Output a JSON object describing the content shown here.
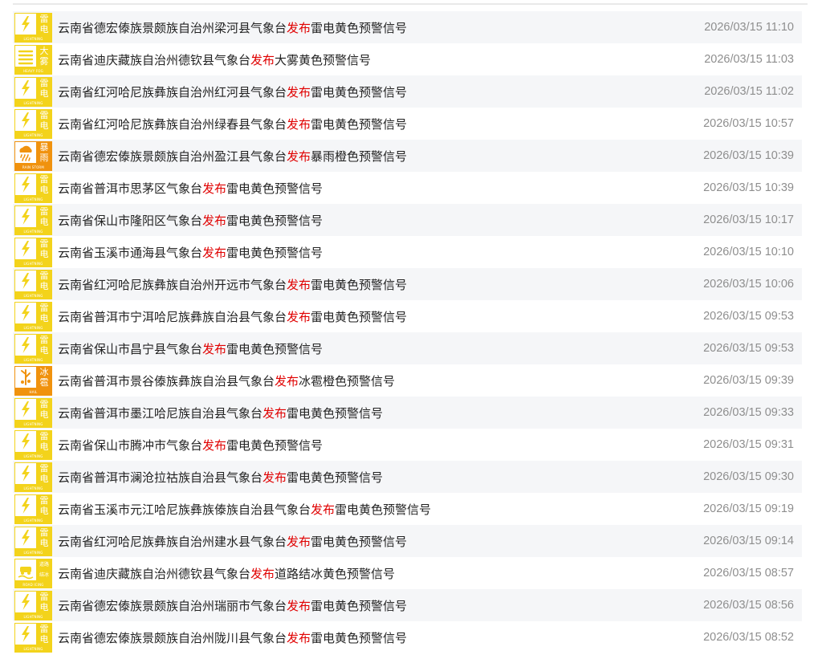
{
  "colors": {
    "yellow_icon": "#f3d31b",
    "orange_icon": "#f0920e",
    "verb_highlight": "#e00000",
    "title_text": "#222222",
    "time_text": "#8e8e8e",
    "row_alt": "#f5f6f8"
  },
  "verb": "发布",
  "icons": {
    "lightning": {
      "chars": [
        "雷",
        "电"
      ],
      "caption": "LIGHTNING",
      "color": "yellow",
      "glyph": "lightning-icon"
    },
    "fog": {
      "chars": [
        "大",
        "雾"
      ],
      "caption": "HEAVY FOG",
      "color": "yellow",
      "glyph": "fog-icon"
    },
    "rainstorm": {
      "chars": [
        "暴",
        "雨"
      ],
      "caption": "RAIN STORM",
      "color": "orange",
      "glyph": "rainstorm-icon"
    },
    "hail": {
      "chars": [
        "冰",
        "雹"
      ],
      "caption": "HAIL",
      "color": "orange",
      "glyph": "hail-icon"
    },
    "road_icing": {
      "chars": [
        "道路",
        "结冰"
      ],
      "caption": "ROAD ICING",
      "color": "yellow",
      "glyph": "road-icing-icon"
    }
  },
  "warnings": [
    {
      "icon": "lightning",
      "prefix": "云南省德宏傣族景颇族自治州梁河县气象台",
      "suffix": "雷电黄色预警信号",
      "time": "2026/03/15 11:10"
    },
    {
      "icon": "fog",
      "prefix": "云南省迪庆藏族自治州德钦县气象台",
      "suffix": "大雾黄色预警信号",
      "time": "2026/03/15 11:03"
    },
    {
      "icon": "lightning",
      "prefix": "云南省红河哈尼族彝族自治州红河县气象台",
      "suffix": "雷电黄色预警信号",
      "time": "2026/03/15 11:02"
    },
    {
      "icon": "lightning",
      "prefix": "云南省红河哈尼族彝族自治州绿春县气象台",
      "suffix": "雷电黄色预警信号",
      "time": "2026/03/15 10:57"
    },
    {
      "icon": "rainstorm",
      "prefix": "云南省德宏傣族景颇族自治州盈江县气象台",
      "suffix": "暴雨橙色预警信号",
      "time": "2026/03/15 10:39"
    },
    {
      "icon": "lightning",
      "prefix": "云南省普洱市思茅区气象台",
      "suffix": "雷电黄色预警信号",
      "time": "2026/03/15 10:39"
    },
    {
      "icon": "lightning",
      "prefix": "云南省保山市隆阳区气象台",
      "suffix": "雷电黄色预警信号",
      "time": "2026/03/15 10:17"
    },
    {
      "icon": "lightning",
      "prefix": "云南省玉溪市通海县气象台",
      "suffix": "雷电黄色预警信号",
      "time": "2026/03/15 10:10"
    },
    {
      "icon": "lightning",
      "prefix": "云南省红河哈尼族彝族自治州开远市气象台",
      "suffix": "雷电黄色预警信号",
      "time": "2026/03/15 10:06"
    },
    {
      "icon": "lightning",
      "prefix": "云南省普洱市宁洱哈尼族彝族自治县气象台",
      "suffix": "雷电黄色预警信号",
      "time": "2026/03/15 09:53"
    },
    {
      "icon": "lightning",
      "prefix": "云南省保山市昌宁县气象台",
      "suffix": "雷电黄色预警信号",
      "time": "2026/03/15 09:53"
    },
    {
      "icon": "hail",
      "prefix": "云南省普洱市景谷傣族彝族自治县气象台",
      "suffix": "冰雹橙色预警信号",
      "time": "2026/03/15 09:39"
    },
    {
      "icon": "lightning",
      "prefix": "云南省普洱市墨江哈尼族自治县气象台",
      "suffix": "雷电黄色预警信号",
      "time": "2026/03/15 09:33"
    },
    {
      "icon": "lightning",
      "prefix": "云南省保山市腾冲市气象台",
      "suffix": "雷电黄色预警信号",
      "time": "2026/03/15 09:31"
    },
    {
      "icon": "lightning",
      "prefix": "云南省普洱市澜沧拉祜族自治县气象台",
      "suffix": "雷电黄色预警信号",
      "time": "2026/03/15 09:30"
    },
    {
      "icon": "lightning",
      "prefix": "云南省玉溪市元江哈尼族彝族傣族自治县气象台",
      "suffix": "雷电黄色预警信号",
      "time": "2026/03/15 09:19"
    },
    {
      "icon": "lightning",
      "prefix": "云南省红河哈尼族彝族自治州建水县气象台",
      "suffix": "雷电黄色预警信号",
      "time": "2026/03/15 09:14"
    },
    {
      "icon": "road_icing",
      "prefix": "云南省迪庆藏族自治州德钦县气象台",
      "suffix": "道路结冰黄色预警信号",
      "time": "2026/03/15 08:57"
    },
    {
      "icon": "lightning",
      "prefix": "云南省德宏傣族景颇族自治州瑞丽市气象台",
      "suffix": "雷电黄色预警信号",
      "time": "2026/03/15 08:56"
    },
    {
      "icon": "lightning",
      "prefix": "云南省德宏傣族景颇族自治州陇川县气象台",
      "suffix": "雷电黄色预警信号",
      "time": "2026/03/15 08:52"
    }
  ]
}
